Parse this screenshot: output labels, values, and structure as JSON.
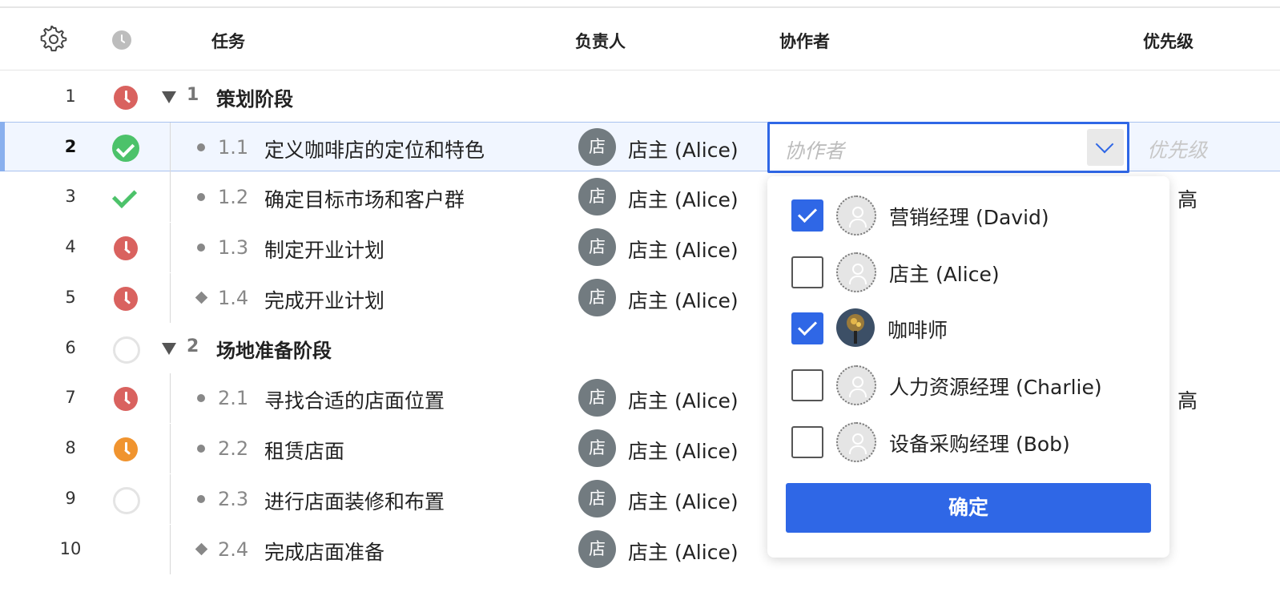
{
  "header": {
    "task": "任务",
    "owner": "负责人",
    "collaborators": "协作者",
    "priority": "优先级"
  },
  "rows": [
    {
      "num": "1",
      "status": "overdue",
      "type": "group",
      "index": "1",
      "title": "策划阶段"
    },
    {
      "num": "2",
      "status": "completed",
      "type": "task",
      "index": "1.1",
      "title": "定义咖啡店的定位和特色",
      "owner_avatar": "店",
      "owner": "店主 (Alice)",
      "priority": ""
    },
    {
      "num": "3",
      "status": "done",
      "type": "task",
      "index": "1.2",
      "title": "确定目标市场和客户群",
      "owner_avatar": "店",
      "owner": "店主 (Alice)",
      "priority": "高"
    },
    {
      "num": "4",
      "status": "overdue",
      "type": "task",
      "index": "1.3",
      "title": "制定开业计划",
      "owner_avatar": "店",
      "owner": "店主 (Alice)",
      "priority": ""
    },
    {
      "num": "5",
      "status": "overdue",
      "type": "milestone",
      "index": "1.4",
      "title": "完成开业计划",
      "owner_avatar": "店",
      "owner": "店主 (Alice)",
      "priority": ""
    },
    {
      "num": "6",
      "status": "not-started",
      "type": "group",
      "index": "2",
      "title": "场地准备阶段"
    },
    {
      "num": "7",
      "status": "overdue",
      "type": "task",
      "index": "2.1",
      "title": "寻找合适的店面位置",
      "owner_avatar": "店",
      "owner": "店主 (Alice)",
      "priority": "高"
    },
    {
      "num": "8",
      "status": "in-progress",
      "type": "task",
      "index": "2.2",
      "title": "租赁店面",
      "owner_avatar": "店",
      "owner": "店主 (Alice)",
      "priority": ""
    },
    {
      "num": "9",
      "status": "not-started",
      "type": "task",
      "index": "2.3",
      "title": "进行店面装修和布置",
      "owner_avatar": "店",
      "owner": "店主 (Alice)",
      "priority": ""
    },
    {
      "num": "10",
      "status": "none",
      "type": "milestone",
      "index": "2.4",
      "title": "完成店面准备",
      "owner_avatar": "店",
      "owner": "店主 (Alice)",
      "priority": ""
    }
  ],
  "editor": {
    "collaborator_placeholder": "协作者",
    "priority_placeholder": "优先级"
  },
  "dropdown": {
    "options": [
      {
        "label": "营销经理 (David)",
        "checked": true,
        "avatar": "placeholder"
      },
      {
        "label": "店主 (Alice)",
        "checked": false,
        "avatar": "placeholder"
      },
      {
        "label": "咖啡师",
        "checked": true,
        "avatar": "photo"
      },
      {
        "label": "人力资源经理 (Charlie)",
        "checked": false,
        "avatar": "placeholder"
      },
      {
        "label": "设备采购经理 (Bob)",
        "checked": false,
        "avatar": "placeholder"
      }
    ],
    "confirm_label": "确定"
  },
  "colors": {
    "accent": "#2f67e6",
    "overdue": "#d9625f",
    "in_progress": "#f0942f",
    "done": "#4cc26a",
    "avatar_bg": "#727b80"
  }
}
